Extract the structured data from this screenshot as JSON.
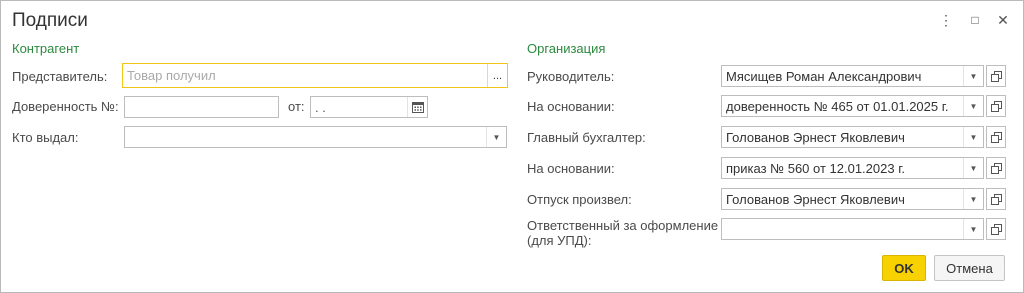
{
  "window": {
    "title": "Подписи",
    "more_icon": "⋮",
    "maximize_icon": "□",
    "close_icon": "✕"
  },
  "counterparty": {
    "section_title": "Контрагент",
    "representative_label": "Представитель:",
    "representative_placeholder": "Товар получил",
    "representative_select": "...",
    "power_of_attorney_label": "Доверенность №:",
    "power_of_attorney_value": "",
    "date_label": "от:",
    "date_value": " .  .",
    "issued_by_label": "Кто выдал:",
    "issued_by_value": ""
  },
  "organization": {
    "section_title": "Организация",
    "rows": [
      {
        "label": "Руководитель:",
        "value": "Мясищев Роман Александрович"
      },
      {
        "label": "На основании:",
        "value": "доверенность № 465 от 01.01.2025 г."
      },
      {
        "label": "Главный бухгалтер:",
        "value": "Голованов Эрнест Яковлевич"
      },
      {
        "label": "На основании:",
        "value": "приказ № 560 от 12.01.2023 г."
      },
      {
        "label": "Отпуск произвел:",
        "value": "Голованов Эрнест Яковлевич"
      }
    ],
    "responsible_label_line1": "Ответственный за оформление",
    "responsible_label_line2": "(для УПД):",
    "responsible_value": ""
  },
  "footer": {
    "ok_label": "OK",
    "cancel_label": "Отмена"
  },
  "colors": {
    "section_title": "#2b8a3e",
    "ok_button": "#f8d100",
    "focus_border": "#f0c419"
  }
}
